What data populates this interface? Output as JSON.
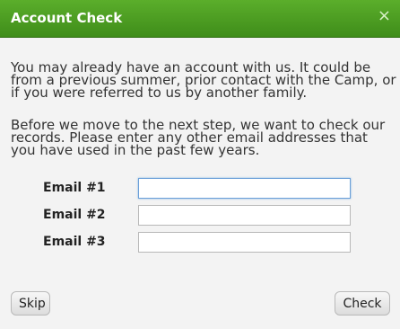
{
  "dialog": {
    "title": "Account Check",
    "close_glyph": "×"
  },
  "content": {
    "paragraph1": "You may already have an account with us. It could be from a previous summer, prior contact with the Camp, or if you were referred to us by another family.",
    "paragraph2": "Before we move to the next step, we want to check our records. Please enter any other email addresses that you have used in the past few years."
  },
  "form": {
    "fields": [
      {
        "label": "Email #1",
        "value": ""
      },
      {
        "label": "Email #2",
        "value": ""
      },
      {
        "label": "Email #3",
        "value": ""
      }
    ]
  },
  "buttons": {
    "skip": "Skip",
    "check": "Check"
  },
  "colors": {
    "titlebar": "#4a9d22",
    "focus_border": "#6a9fd8"
  }
}
